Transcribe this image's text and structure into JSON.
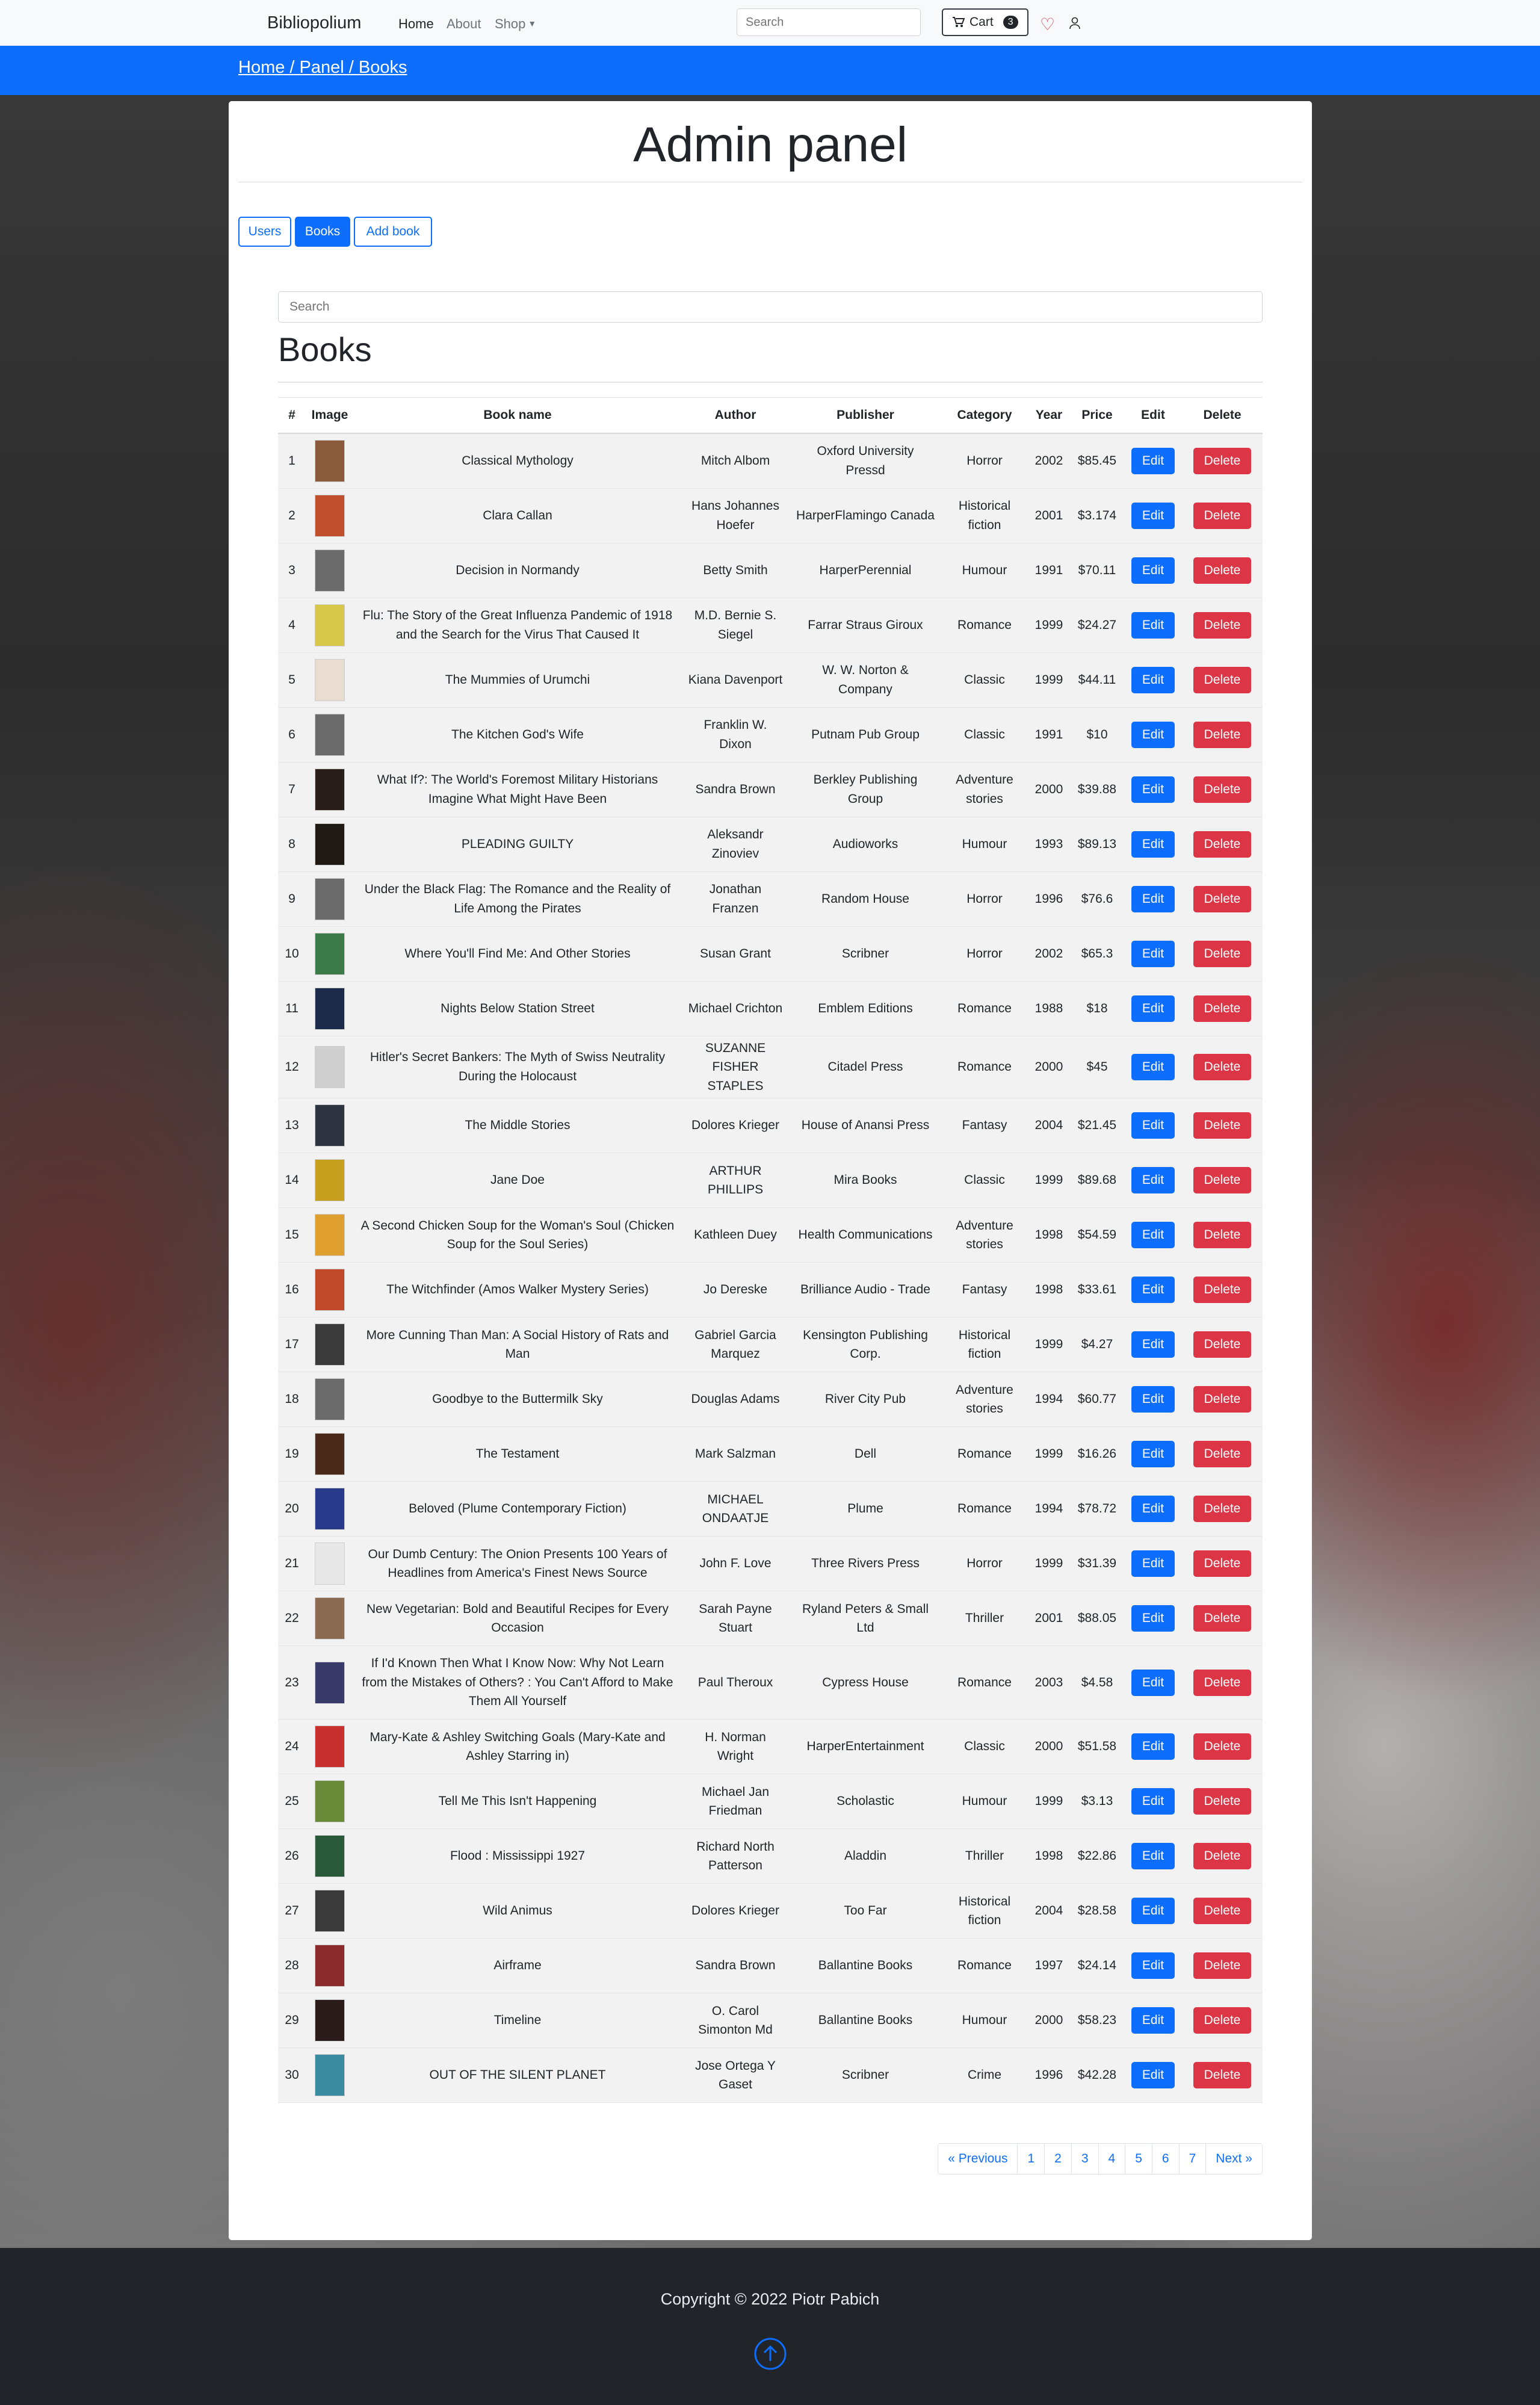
{
  "navbar": {
    "brand": "Bibliopolium",
    "links": {
      "home": "Home",
      "about": "About",
      "shop": "Shop"
    },
    "search_placeholder": "Search",
    "cart_label": "Cart",
    "cart_count": "3"
  },
  "breadcrumb": "Home / Panel / Books",
  "panel": {
    "title": "Admin panel",
    "tabs": {
      "users": "Users",
      "books": "Books",
      "add_book": "Add book"
    },
    "search_placeholder": "Search",
    "books_heading": "Books"
  },
  "table": {
    "headers": [
      "#",
      "Image",
      "Book name",
      "Author",
      "Publisher",
      "Category",
      "Year",
      "Price",
      "Edit",
      "Delete"
    ],
    "edit_label": "Edit",
    "delete_label": "Delete",
    "rows": [
      {
        "num": "1",
        "name": "Classical Mythology",
        "author": "Mitch Albom",
        "publisher": "Oxford University Pressd",
        "category": "Horror",
        "year": "2002",
        "price": "$85.45",
        "cover": "#8a5a3c"
      },
      {
        "num": "2",
        "name": "Clara Callan",
        "author": "Hans Johannes Hoefer",
        "publisher": "HarperFlamingo Canada",
        "category": "Historical fiction",
        "year": "2001",
        "price": "$3.174",
        "cover": "#c1502e"
      },
      {
        "num": "3",
        "name": "Decision in Normandy",
        "author": "Betty Smith",
        "publisher": "HarperPerennial",
        "category": "Humour",
        "year": "1991",
        "price": "$70.11",
        "cover": "#6b6b6b"
      },
      {
        "num": "4",
        "name": "Flu: The Story of the Great Influenza Pandemic of 1918 and the Search for the Virus That Caused It",
        "author": "M.D. Bernie S. Siegel",
        "publisher": "Farrar Straus Giroux",
        "category": "Romance",
        "year": "1999",
        "price": "$24.27",
        "cover": "#d8c84a"
      },
      {
        "num": "5",
        "name": "The Mummies of Urumchi",
        "author": "Kiana Davenport",
        "publisher": "W. W. Norton & Company",
        "category": "Classic",
        "year": "1999",
        "price": "$44.11",
        "cover": "#e8ddd0"
      },
      {
        "num": "6",
        "name": "The Kitchen God's Wife",
        "author": "Franklin W. Dixon",
        "publisher": "Putnam Pub Group",
        "category": "Classic",
        "year": "1991",
        "price": "$10",
        "cover": "#6b6b6b"
      },
      {
        "num": "7",
        "name": "What If?: The World's Foremost Military Historians Imagine What Might Have Been",
        "author": "Sandra Brown",
        "publisher": "Berkley Publishing Group",
        "category": "Adventure stories",
        "year": "2000",
        "price": "$39.88",
        "cover": "#2a1e1a"
      },
      {
        "num": "8",
        "name": "PLEADING GUILTY",
        "author": "Aleksandr Zinoviev",
        "publisher": "Audioworks",
        "category": "Humour",
        "year": "1993",
        "price": "$89.13",
        "cover": "#1f1a14"
      },
      {
        "num": "9",
        "name": "Under the Black Flag: The Romance and the Reality of Life Among the Pirates",
        "author": "Jonathan Franzen",
        "publisher": "Random House",
        "category": "Horror",
        "year": "1996",
        "price": "$76.6",
        "cover": "#6b6b6b"
      },
      {
        "num": "10",
        "name": "Where You'll Find Me: And Other Stories",
        "author": "Susan Grant",
        "publisher": "Scribner",
        "category": "Horror",
        "year": "2002",
        "price": "$65.3",
        "cover": "#3c7a4a"
      },
      {
        "num": "11",
        "name": "Nights Below Station Street",
        "author": "Michael Crichton",
        "publisher": "Emblem Editions",
        "category": "Romance",
        "year": "1988",
        "price": "$18",
        "cover": "#1c2a4a"
      },
      {
        "num": "12",
        "name": "Hitler's Secret Bankers: The Myth of Swiss Neutrality During the Holocaust",
        "author": "SUZANNE FISHER STAPLES",
        "publisher": "Citadel Press",
        "category": "Romance",
        "year": "2000",
        "price": "$45",
        "cover": "#cfcfcf"
      },
      {
        "num": "13",
        "name": "The Middle Stories",
        "author": "Dolores Krieger",
        "publisher": "House of Anansi Press",
        "category": "Fantasy",
        "year": "2004",
        "price": "$21.45",
        "cover": "#2e3440"
      },
      {
        "num": "14",
        "name": "Jane Doe",
        "author": "ARTHUR PHILLIPS",
        "publisher": "Mira Books",
        "category": "Classic",
        "year": "1999",
        "price": "$89.68",
        "cover": "#c8a020"
      },
      {
        "num": "15",
        "name": "A Second Chicken Soup for the Woman's Soul (Chicken Soup for the Soul Series)",
        "author": "Kathleen Duey",
        "publisher": "Health Communications",
        "category": "Adventure stories",
        "year": "1998",
        "price": "$54.59",
        "cover": "#e0a030"
      },
      {
        "num": "16",
        "name": "The Witchfinder (Amos Walker Mystery Series)",
        "author": "Jo Dereske",
        "publisher": "Brilliance Audio - Trade",
        "category": "Fantasy",
        "year": "1998",
        "price": "$33.61",
        "cover": "#c04a2a"
      },
      {
        "num": "17",
        "name": "More Cunning Than Man: A Social History of Rats and Man",
        "author": "Gabriel Garcia Marquez",
        "publisher": "Kensington Publishing Corp.",
        "category": "Historical fiction",
        "year": "1999",
        "price": "$4.27",
        "cover": "#3a3a3a"
      },
      {
        "num": "18",
        "name": "Goodbye to the Buttermilk Sky",
        "author": "Douglas Adams",
        "publisher": "River City Pub",
        "category": "Adventure stories",
        "year": "1994",
        "price": "$60.77",
        "cover": "#6b6b6b"
      },
      {
        "num": "19",
        "name": "The Testament",
        "author": "Mark Salzman",
        "publisher": "Dell",
        "category": "Romance",
        "year": "1999",
        "price": "$16.26",
        "cover": "#4a2a1a"
      },
      {
        "num": "20",
        "name": "Beloved (Plume Contemporary Fiction)",
        "author": "MICHAEL ONDAATJE",
        "publisher": "Plume",
        "category": "Romance",
        "year": "1994",
        "price": "$78.72",
        "cover": "#2a3a8a"
      },
      {
        "num": "21",
        "name": "Our Dumb Century: The Onion Presents 100 Years of Headlines from America's Finest News Source",
        "author": "John F. Love",
        "publisher": "Three Rivers Press",
        "category": "Horror",
        "year": "1999",
        "price": "$31.39",
        "cover": "#e8e8e8"
      },
      {
        "num": "22",
        "name": "New Vegetarian: Bold and Beautiful Recipes for Every Occasion",
        "author": "Sarah Payne Stuart",
        "publisher": "Ryland Peters & Small Ltd",
        "category": "Thriller",
        "year": "2001",
        "price": "$88.05",
        "cover": "#8a6a50"
      },
      {
        "num": "23",
        "name": "If I'd Known Then What I Know Now: Why Not Learn from the Mistakes of Others? : You Can't Afford to Make Them All Yourself",
        "author": "Paul Theroux",
        "publisher": "Cypress House",
        "category": "Romance",
        "year": "2003",
        "price": "$4.58",
        "cover": "#3a3a6a"
      },
      {
        "num": "24",
        "name": "Mary-Kate & Ashley Switching Goals (Mary-Kate and Ashley Starring in)",
        "author": "H. Norman Wright",
        "publisher": "HarperEntertainment",
        "category": "Classic",
        "year": "2000",
        "price": "$51.58",
        "cover": "#c83030"
      },
      {
        "num": "25",
        "name": "Tell Me This Isn't Happening",
        "author": "Michael Jan Friedman",
        "publisher": "Scholastic",
        "category": "Humour",
        "year": "1999",
        "price": "$3.13",
        "cover": "#6a8a3a"
      },
      {
        "num": "26",
        "name": "Flood : Mississippi 1927",
        "author": "Richard North Patterson",
        "publisher": "Aladdin",
        "category": "Thriller",
        "year": "1998",
        "price": "$22.86",
        "cover": "#2a5a3a"
      },
      {
        "num": "27",
        "name": "Wild Animus",
        "author": "Dolores Krieger",
        "publisher": "Too Far",
        "category": "Historical fiction",
        "year": "2004",
        "price": "$28.58",
        "cover": "#3a3a3a"
      },
      {
        "num": "28",
        "name": "Airframe",
        "author": "Sandra Brown",
        "publisher": "Ballantine Books",
        "category": "Romance",
        "year": "1997",
        "price": "$24.14",
        "cover": "#8a2a2a"
      },
      {
        "num": "29",
        "name": "Timeline",
        "author": "O. Carol Simonton Md",
        "publisher": "Ballantine Books",
        "category": "Humour",
        "year": "2000",
        "price": "$58.23",
        "cover": "#2a1a1a"
      },
      {
        "num": "30",
        "name": "OUT OF THE SILENT PLANET",
        "author": "Jose Ortega Y Gaset",
        "publisher": "Scribner",
        "category": "Crime",
        "year": "1996",
        "price": "$42.28",
        "cover": "#3a8aa0"
      }
    ]
  },
  "pagination": [
    "« Previous",
    "1",
    "2",
    "3",
    "4",
    "5",
    "6",
    "7",
    "Next »"
  ],
  "footer": {
    "copyright": "Copyright © 2022 Piotr Pabich"
  }
}
